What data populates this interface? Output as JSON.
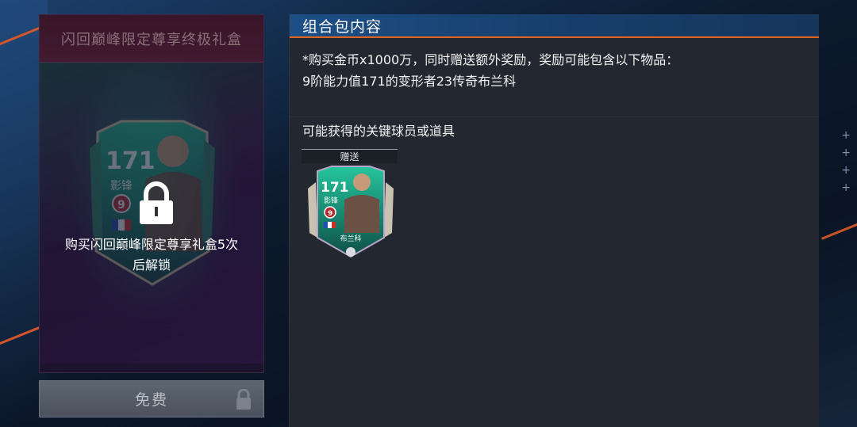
{
  "left_panel": {
    "title": "闪回巅峰限定尊享终极礼盒",
    "card": {
      "rating": "171",
      "position": "影锋",
      "level": "9",
      "nation_flag": "france-flag"
    },
    "lock_text_line1": "购买闪回巅峰限定尊享礼盒5次",
    "lock_text_line2": "后解锁",
    "lock_icon": "lock-icon"
  },
  "free_button": {
    "label": "免费",
    "icon": "lock-icon"
  },
  "right_panel": {
    "title": "组合包内容",
    "desc_line1": "*购买金币x1000万，同时赠送额外奖励，奖励可能包含以下物品：",
    "desc_line2": "9阶能力值171的变形者23传奇布兰科",
    "section_title": "可能获得的关键球员或道具",
    "items": [
      {
        "tag": "赠送",
        "rating": "171",
        "position": "影锋",
        "level": "9",
        "player_name": "布兰科",
        "nation_flag": "france-flag"
      }
    ]
  },
  "colors": {
    "header_accent": "#e2641f",
    "header_blue": "#1d4f86",
    "card_green": "#1ea487",
    "panel_bg": "#232830"
  }
}
